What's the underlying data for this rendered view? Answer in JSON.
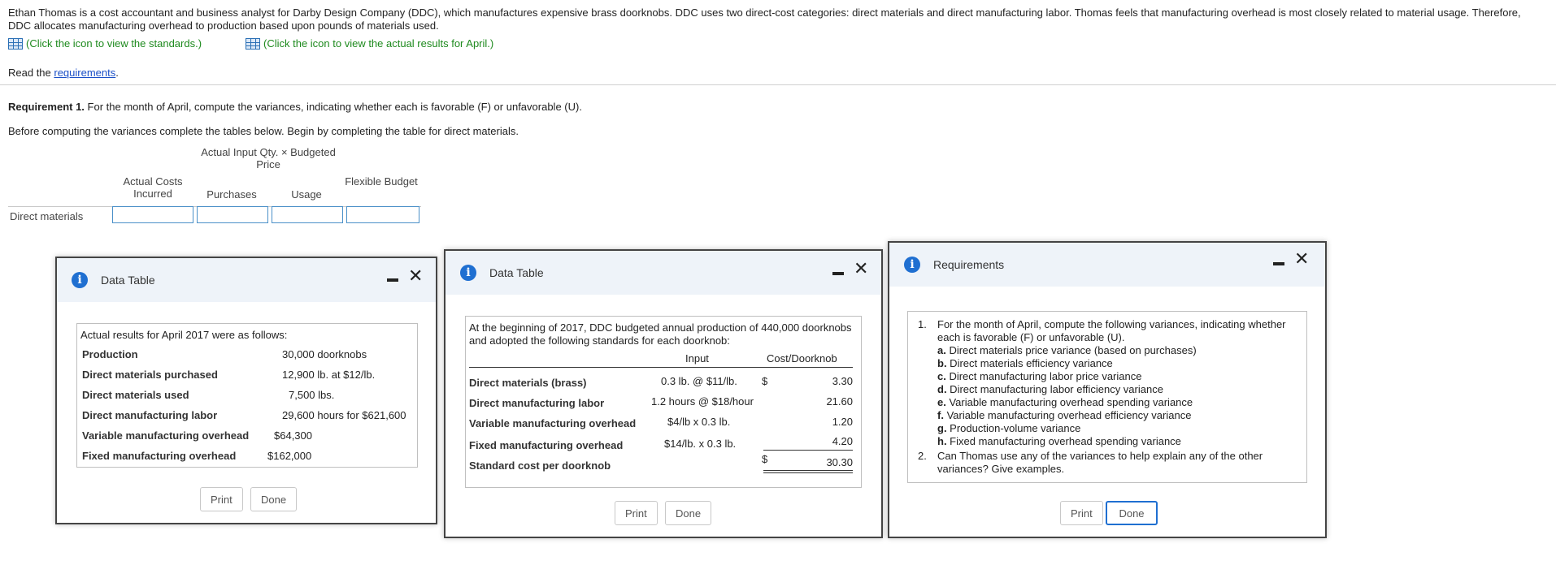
{
  "intro_text": "Ethan Thomas is a cost accountant and business analyst for Darby Design Company (DDC), which manufactures expensive brass doorknobs. DDC uses two direct-cost categories: direct materials and direct manufacturing labor. Thomas feels that manufacturing overhead is most closely related to material usage. Therefore, DDC allocates manufacturing overhead to production based upon pounds of materials used.",
  "links": {
    "standards": "(Click the icon to view the standards.)",
    "actual": "(Click the icon to view the actual results for April.)"
  },
  "read": {
    "prefix": "Read the ",
    "link": "requirements",
    "suffix": "."
  },
  "requirement1": {
    "label": "Requirement 1.",
    "text": " For the month of April, compute the variances, indicating whether each is favorable (F) or unfavorable (U)."
  },
  "before_text": "Before computing the variances complete the tables below. Begin by completing the table for direct materials.",
  "table": {
    "group_header": "Actual Input Qty. × Budgeted Price",
    "col_actual": "Actual Costs Incurred",
    "col_purchases": "Purchases",
    "col_usage": "Usage",
    "col_flexible": "Flexible Budget",
    "row_label": "Direct materials",
    "inputs": [
      "",
      "",
      "",
      ""
    ]
  },
  "win_actual": {
    "title": "Data Table",
    "heading": "Actual results for April 2017 were as follows:",
    "rows": [
      {
        "label": "Production",
        "value": "30,000 doorknobs"
      },
      {
        "label": "Direct materials purchased",
        "value": "12,900 lb. at $12/lb."
      },
      {
        "label": "Direct materials used",
        "value": "7,500 lbs."
      },
      {
        "label": "Direct manufacturing labor",
        "value": "29,600 hours for $621,600"
      },
      {
        "label": "Variable manufacturing overhead",
        "value": "$64,300"
      },
      {
        "label": "Fixed manufacturing overhead",
        "value": "$162,000"
      }
    ],
    "print": "Print",
    "done": "Done"
  },
  "win_standards": {
    "title": "Data Table",
    "heading": "At the beginning of 2017, DDC budgeted annual production of 440,000 doorknobs and adopted the following standards for each doorknob:",
    "col_input": "Input",
    "col_cost": "Cost/Doorknob",
    "rows": [
      {
        "label": "Direct materials (brass)",
        "input": "0.3 lb. @ $11/lb.",
        "dollar": "$",
        "cost": "3.30"
      },
      {
        "label": "Direct manufacturing labor",
        "input": "1.2 hours @ $18/hour",
        "dollar": "",
        "cost": "21.60"
      },
      {
        "label": "Variable manufacturing overhead",
        "input": "$4/lb x 0.3 lb.",
        "dollar": "",
        "cost": "1.20"
      },
      {
        "label": "Fixed manufacturing overhead",
        "input": "$14/lb. x 0.3 lb.",
        "dollar": "",
        "cost": "4.20"
      }
    ],
    "total_label": "Standard cost per doorknob",
    "total_dollar": "$",
    "total_cost": "30.30",
    "print": "Print",
    "done": "Done"
  },
  "win_requirements": {
    "title": "Requirements",
    "item1_num": "1.",
    "item1_text": "For the month of April, compute the following variances, indicating whether each is favorable (F) or unfavorable (U).",
    "subitems": [
      {
        "letter": "a.",
        "text": " Direct materials price variance (based on purchases)"
      },
      {
        "letter": "b.",
        "text": " Direct materials efficiency variance"
      },
      {
        "letter": "c.",
        "text": " Direct manufacturing labor price variance"
      },
      {
        "letter": "d.",
        "text": " Direct manufacturing labor efficiency variance"
      },
      {
        "letter": "e.",
        "text": " Variable manufacturing overhead spending variance"
      },
      {
        "letter": "f.",
        "text": " Variable manufacturing overhead efficiency variance"
      },
      {
        "letter": "g.",
        "text": " Production-volume variance"
      },
      {
        "letter": "h.",
        "text": " Fixed manufacturing overhead spending variance"
      }
    ],
    "item2_num": "2.",
    "item2_text": "Can Thomas use any of the variances to help explain any of the other variances? Give examples.",
    "print": "Print",
    "done": "Done"
  }
}
